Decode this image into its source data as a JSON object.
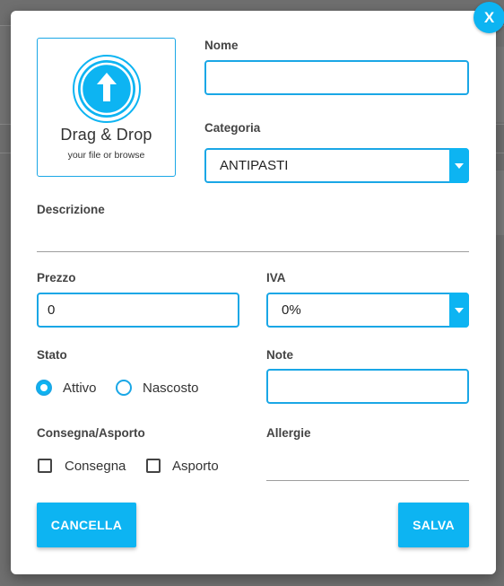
{
  "modal": {
    "close_label": "X"
  },
  "dropzone": {
    "title": "Drag & Drop",
    "subtitle": "your file or browse",
    "icon": "upload-arrow-icon"
  },
  "form": {
    "nome": {
      "label": "Nome",
      "value": ""
    },
    "categoria": {
      "label": "Categoria",
      "selected": "ANTIPASTI"
    },
    "descrizione": {
      "label": "Descrizione",
      "value": ""
    },
    "prezzo": {
      "label": "Prezzo",
      "value": "0"
    },
    "iva": {
      "label": "IVA",
      "selected": "0%"
    },
    "stato": {
      "label": "Stato",
      "options": [
        {
          "label": "Attivo",
          "checked": true
        },
        {
          "label": "Nascosto",
          "checked": false
        }
      ]
    },
    "note": {
      "label": "Note",
      "value": ""
    },
    "consegna_asporto": {
      "label": "Consegna/Asporto",
      "options": [
        {
          "label": "Consegna",
          "checked": false
        },
        {
          "label": "Asporto",
          "checked": false
        }
      ]
    },
    "allergie": {
      "label": "Allergie",
      "value": ""
    }
  },
  "actions": {
    "cancel_label": "CANCELLA",
    "save_label": "SALVA"
  },
  "colors": {
    "accent": "#0db4f2",
    "border": "#1aa7e6",
    "overlay": "#6f6f6f"
  }
}
